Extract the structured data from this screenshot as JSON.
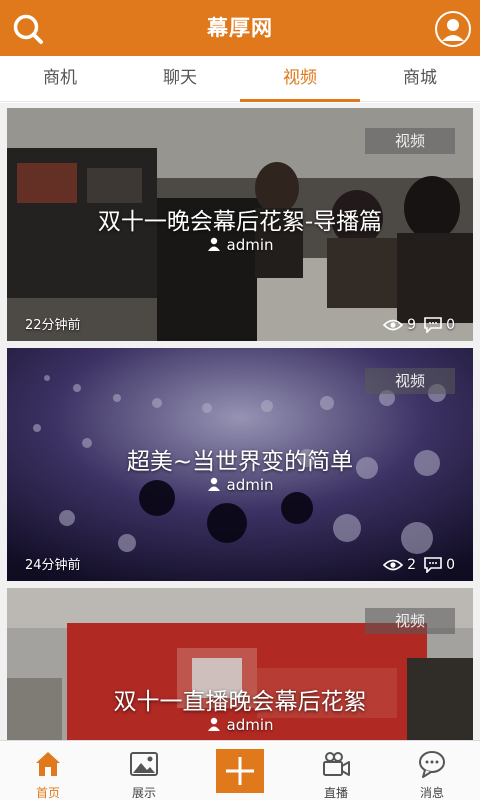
{
  "header": {
    "title": "幕厚网",
    "search_icon": "search-icon",
    "user_icon": "user-avatar-icon"
  },
  "tabs": [
    {
      "label": "商机",
      "active": false
    },
    {
      "label": "聊天",
      "active": false
    },
    {
      "label": "视频",
      "active": true
    },
    {
      "label": "商城",
      "active": false
    }
  ],
  "feed": {
    "items": [
      {
        "tag": "视频",
        "title": "双十一晚会幕后花絮-导播篇",
        "author": "admin",
        "time": "22分钟前",
        "views": "9",
        "comments": "0"
      },
      {
        "tag": "视频",
        "title": "超美~当世界变的简单",
        "author": "admin",
        "time": "24分钟前",
        "views": "2",
        "comments": "0"
      },
      {
        "tag": "视频",
        "title": "双十一直播晚会幕后花絮",
        "author": "admin"
      }
    ]
  },
  "bottom_nav": {
    "items": [
      {
        "label": "首页",
        "icon": "home-icon",
        "active": true
      },
      {
        "label": "展示",
        "icon": "image-icon",
        "active": false
      },
      {
        "label": "",
        "icon": "plus-icon",
        "active": false
      },
      {
        "label": "直播",
        "icon": "video-camera-icon",
        "active": false
      },
      {
        "label": "消息",
        "icon": "chat-bubble-icon",
        "active": false
      }
    ]
  },
  "colors": {
    "accent": "#e0791c",
    "tab_text": "#555555"
  }
}
